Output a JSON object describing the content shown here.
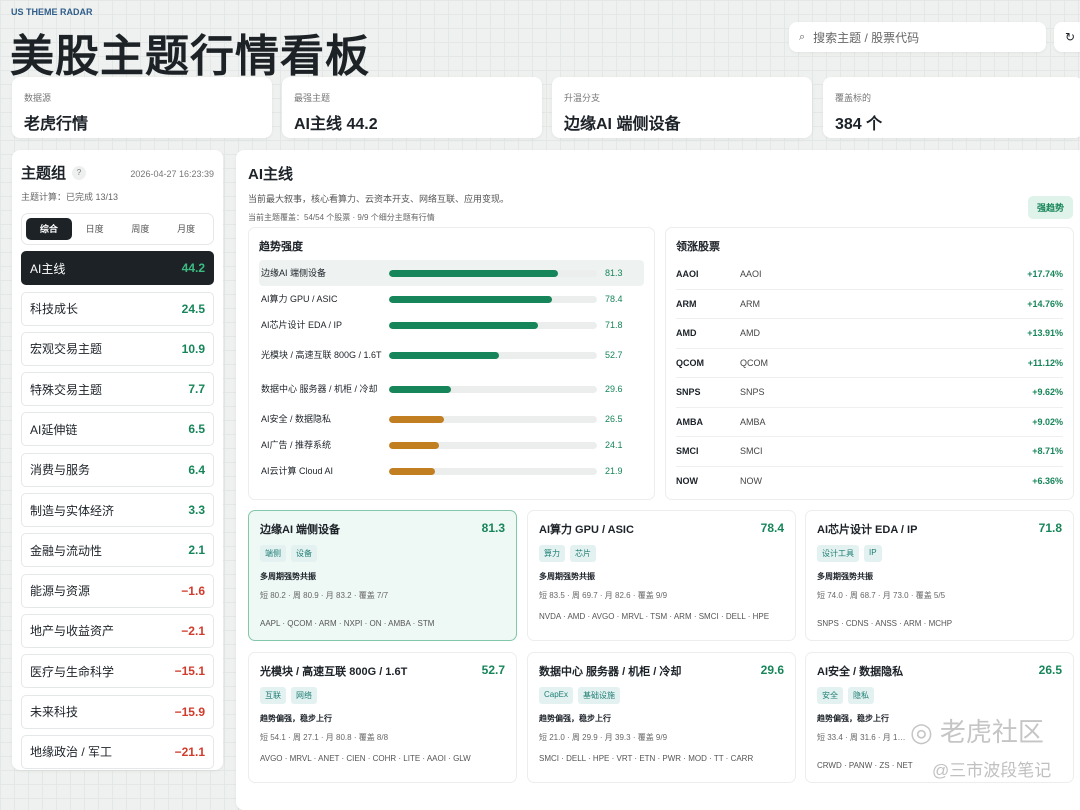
{
  "header": {
    "brand": "US THEME RADAR",
    "title": "美股主题行情看板",
    "search_placeholder": "搜索主题 / 股票代码",
    "search_icon": "⌕",
    "refresh_icon": "↻"
  },
  "stats": [
    {
      "label": "数据源",
      "value": "老虎行情"
    },
    {
      "label": "最强主题",
      "value": "AI主线 44.2"
    },
    {
      "label": "升温分支",
      "value": "边缘AI 端侧设备"
    },
    {
      "label": "覆盖标的",
      "value": "384 个"
    }
  ],
  "sidebar": {
    "title": "主题组",
    "help": "?",
    "timestamp": "2026-04-27 16:23:39",
    "progress": "主题计算：已完成 13/13",
    "tabs": [
      "综合",
      "日度",
      "周度",
      "月度"
    ],
    "groups": [
      {
        "name": "AI主线",
        "score": "44.2"
      },
      {
        "name": "科技成长",
        "score": "24.5"
      },
      {
        "name": "宏观交易主题",
        "score": "10.9"
      },
      {
        "name": "特殊交易主题",
        "score": "7.7"
      },
      {
        "name": "AI延伸链",
        "score": "6.5"
      },
      {
        "name": "消费与服务",
        "score": "6.4"
      },
      {
        "name": "制造与实体经济",
        "score": "3.3"
      },
      {
        "name": "金融与流动性",
        "score": "2.1"
      },
      {
        "name": "能源与资源",
        "score": "−1.6"
      },
      {
        "name": "地产与收益资产",
        "score": "−2.1"
      },
      {
        "name": "医疗与生命科学",
        "score": "−15.1"
      },
      {
        "name": "未来科技",
        "score": "−15.9"
      },
      {
        "name": "地缘政治 / 军工",
        "score": "−21.1"
      }
    ]
  },
  "main": {
    "title": "AI主线",
    "desc": "当前最大叙事，核心看算力、云资本开支、网络互联、应用变现。",
    "coverage": "当前主题覆盖：54/54 个股票 · 9/9 个细分主题有行情",
    "badge": "强趋势",
    "trend_title": "趋势强度",
    "trend": [
      {
        "name": "边缘AI 端侧设备",
        "value": 81.3,
        "label": "81.3"
      },
      {
        "name": "AI算力 GPU / ASIC",
        "value": 78.4,
        "label": "78.4"
      },
      {
        "name": "AI芯片设计 EDA / IP",
        "value": 71.8,
        "label": "71.8"
      },
      {
        "name": "光模块 / 高速互联 800G / 1.6T",
        "value": 52.7,
        "label": "52.7"
      },
      {
        "name": "数据中心 服务器 / 机柜 / 冷却",
        "value": 29.6,
        "label": "29.6"
      },
      {
        "name": "AI安全 / 数据隐私",
        "value": 26.5,
        "label": "26.5"
      },
      {
        "name": "AI广告 / 推荐系统",
        "value": 24.1,
        "label": "24.1"
      },
      {
        "name": "AI云计算 Cloud AI",
        "value": 21.9,
        "label": "21.9"
      }
    ],
    "leaders_title": "领涨股票",
    "leaders": [
      {
        "ticker": "AAOI",
        "name": "AAOI",
        "pct": "+17.74%"
      },
      {
        "ticker": "ARM",
        "name": "ARM",
        "pct": "+14.76%"
      },
      {
        "ticker": "AMD",
        "name": "AMD",
        "pct": "+13.91%"
      },
      {
        "ticker": "QCOM",
        "name": "QCOM",
        "pct": "+11.12%"
      },
      {
        "ticker": "SNPS",
        "name": "SNPS",
        "pct": "+9.62%"
      },
      {
        "ticker": "AMBA",
        "name": "AMBA",
        "pct": "+9.02%"
      },
      {
        "ticker": "SMCI",
        "name": "SMCI",
        "pct": "+8.71%"
      },
      {
        "ticker": "NOW",
        "name": "NOW",
        "pct": "+6.36%"
      }
    ],
    "cards": [
      {
        "title": "边缘AI 端侧设备",
        "score": "81.3",
        "tags": [
          "端侧",
          "设备"
        ],
        "status": "多周期强势共振",
        "metrics": "短 80.2 · 周 80.9 · 月 83.2 · 覆盖 7/7",
        "tickers": "AAPL · QCOM · ARM · NXPI · ON · AMBA · STM"
      },
      {
        "title": "AI算力 GPU / ASIC",
        "score": "78.4",
        "tags": [
          "算力",
          "芯片"
        ],
        "status": "多周期强势共振",
        "metrics": "短 83.5 · 周 69.7 · 月 82.6 · 覆盖 9/9",
        "tickers": "NVDA · AMD · AVGO · MRVL · TSM · ARM · SMCI · DELL · HPE"
      },
      {
        "title": "AI芯片设计 EDA / IP",
        "score": "71.8",
        "tags": [
          "设计工具",
          "IP"
        ],
        "status": "多周期强势共振",
        "metrics": "短 74.0 · 周 68.7 · 月 73.0 · 覆盖 5/5",
        "tickers": "SNPS · CDNS · ANSS · ARM · MCHP"
      },
      {
        "title": "光模块 / 高速互联 800G / 1.6T",
        "score": "52.7",
        "tags": [
          "互联",
          "网络"
        ],
        "status": "趋势偏强，稳步上行",
        "metrics": "短 54.1 · 周 27.1 · 月 80.8 · 覆盖 8/8",
        "tickers": "AVGO · MRVL · ANET · CIEN · COHR · LITE · AAOI · GLW"
      },
      {
        "title": "数据中心 服务器 / 机柜 / 冷却",
        "score": "29.6",
        "tags": [
          "CapEx",
          "基础设施"
        ],
        "status": "趋势偏强，稳步上行",
        "metrics": "短 21.0 · 周 29.9 · 月 39.3 · 覆盖 9/9",
        "tickers": "SMCI · DELL · HPE · VRT · ETN · PWR · MOD · TT · CARR"
      },
      {
        "title": "AI安全 / 数据隐私",
        "score": "26.5",
        "tags": [
          "安全",
          "隐私"
        ],
        "status": "趋势偏强，稳步上行",
        "metrics": "短 33.4 · 周 31.6 · 月 1…",
        "tickers": "CRWD · PANW · ZS · NET"
      }
    ]
  },
  "watermark": {
    "line1": "老虎社区",
    "line2": "@三市波段笔记"
  },
  "colors": {
    "strong": "#17855a",
    "weak": "#c17f22",
    "negative": "#d13b2b"
  }
}
